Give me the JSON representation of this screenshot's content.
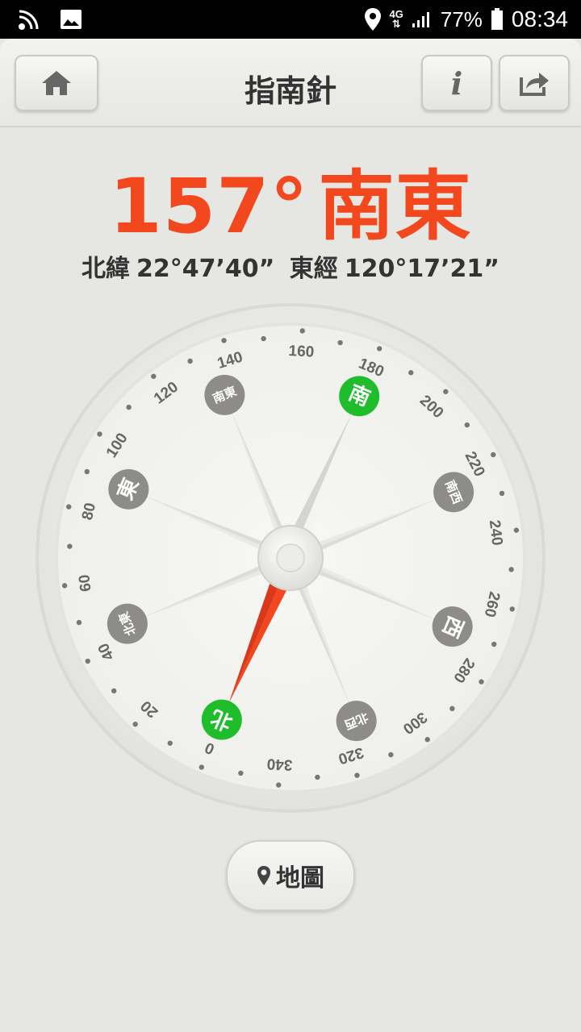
{
  "status_bar": {
    "network": "4G",
    "battery": "77%",
    "time": "08:34"
  },
  "header": {
    "title": "指南針"
  },
  "reading": {
    "degrees": "157°",
    "direction": "南東",
    "lat_label": "北緯",
    "lat_value": "22°47’40”",
    "lon_label": "東經",
    "lon_value": "120°17’21”"
  },
  "compass": {
    "heading_deg": 157,
    "scale_labels": [
      "0",
      "20",
      "40",
      "60",
      "80",
      "100",
      "120",
      "140",
      "160",
      "180",
      "200",
      "220",
      "240",
      "260",
      "280",
      "300",
      "320",
      "340"
    ],
    "cardinals": [
      {
        "label": "北",
        "active": true
      },
      {
        "label": "北東",
        "active": false
      },
      {
        "label": "東",
        "active": false
      },
      {
        "label": "南東",
        "active": false
      },
      {
        "label": "南",
        "active": true
      },
      {
        "label": "南西",
        "active": false
      },
      {
        "label": "西",
        "active": false
      },
      {
        "label": "北西",
        "active": false
      }
    ],
    "colors": {
      "active": "#1fbd2c",
      "inactive": "#8d8c89",
      "needle": "#f3471d"
    }
  },
  "map_button": {
    "label": "地圖"
  }
}
